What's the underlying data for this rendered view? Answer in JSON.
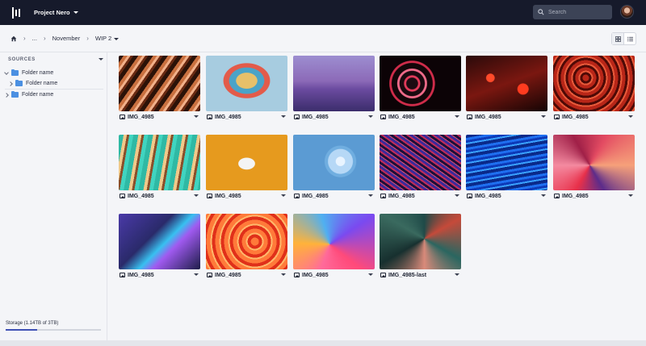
{
  "topbar": {
    "project_name": "Project Nero",
    "search_placeholder": "Search"
  },
  "breadcrumb": {
    "items": [
      "...",
      "November",
      "WIP 2"
    ]
  },
  "sidebar": {
    "section_title": "SOURCES",
    "tree": [
      {
        "label": "Folder name",
        "expanded": true
      },
      {
        "label": "Folder name",
        "expanded": false
      },
      {
        "label": "Folder name",
        "expanded": false
      }
    ],
    "storage_label": "Storage (1.14TB of 3TB)",
    "storage_used_fraction": 0.33
  },
  "images": [
    {
      "name": "IMG_4985"
    },
    {
      "name": "IMG_4985"
    },
    {
      "name": "IMG_4985"
    },
    {
      "name": "IMG_4985"
    },
    {
      "name": "IMG_4985"
    },
    {
      "name": "IMG_4985"
    },
    {
      "name": "IMG_4985"
    },
    {
      "name": "IMG_4985"
    },
    {
      "name": "IMG_4985"
    },
    {
      "name": "IMG_4985"
    },
    {
      "name": "IMG_4985"
    },
    {
      "name": "IMG_4985"
    },
    {
      "name": "IMG_4985"
    },
    {
      "name": "IMG_4985"
    },
    {
      "name": "IMG_4985"
    },
    {
      "name": "IMG_4985-last"
    }
  ],
  "colors": {
    "topbar_bg": "#161a2b",
    "folder_icon": "#4b90e2",
    "storage_fill": "#3f51b5"
  }
}
